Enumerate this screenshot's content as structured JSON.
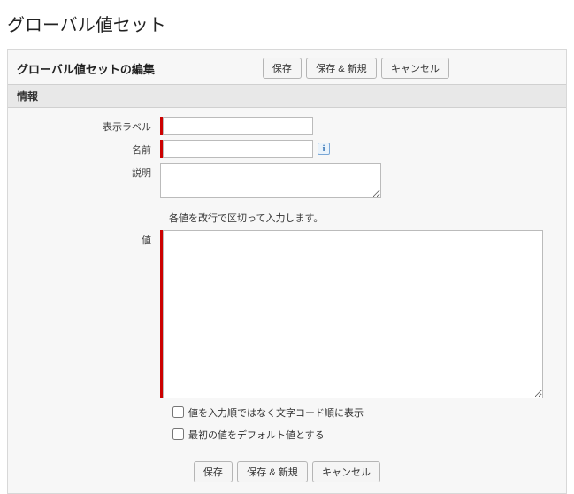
{
  "page": {
    "title": "グローバル値セット"
  },
  "panel": {
    "title": "グローバル値セットの編集"
  },
  "buttons": {
    "save": "保存",
    "save_new": "保存 & 新規",
    "cancel": "キャンセル"
  },
  "section": {
    "info": "情報"
  },
  "labels": {
    "display_label": "表示ラベル",
    "name": "名前",
    "description": "説明",
    "values": "値"
  },
  "fields": {
    "display_label": "",
    "name": "",
    "description": "",
    "values": ""
  },
  "hint": "各値を改行で区切って入力します。",
  "checkboxes": {
    "sort_alpha": "値を入力順ではなく文字コード順に表示",
    "first_default": "最初の値をデフォルト値とする"
  },
  "icons": {
    "info": "i"
  }
}
